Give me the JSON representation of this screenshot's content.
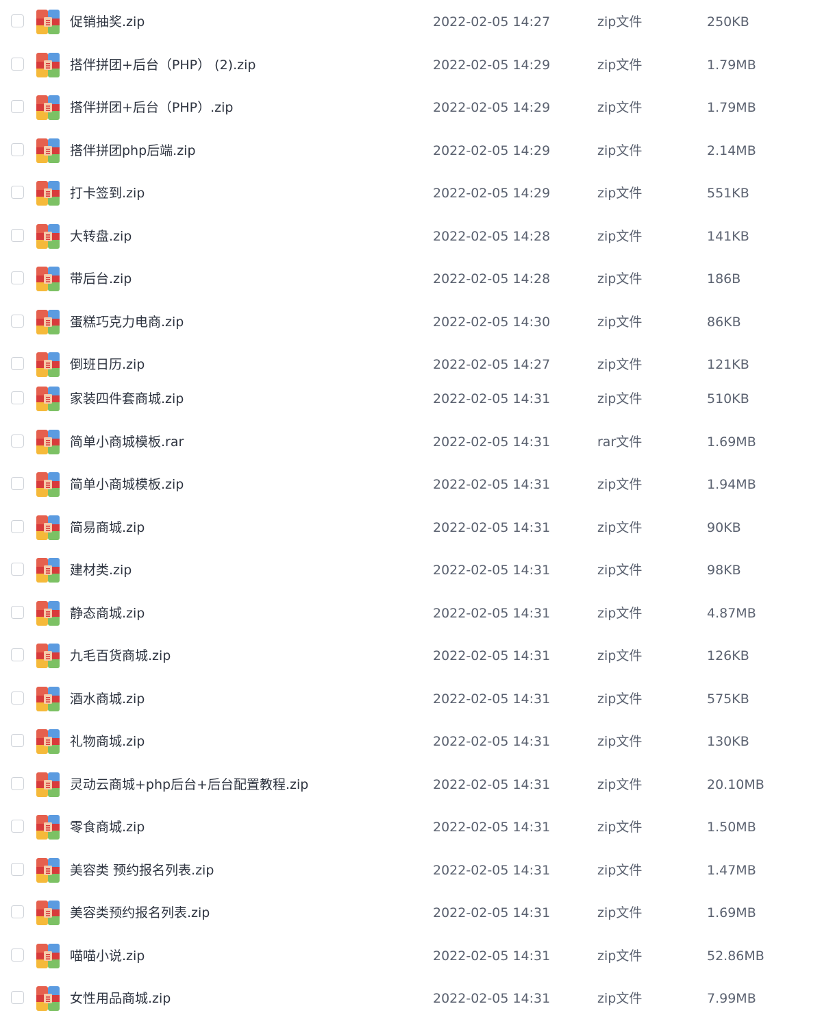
{
  "file_list": {
    "icon": "archive-file-icon",
    "colors": {
      "icon_top_left": "#e5604e",
      "icon_top_right": "#5b9be0",
      "icon_bottom_left": "#f5b93a",
      "icon_bottom_right": "#7cc164",
      "icon_band": "#d83b3b",
      "icon_tag": "#f6c9a8"
    },
    "rows": [
      {
        "name": "促销抽奖.zip",
        "date": "2022-02-05 14:27",
        "type": "zip文件",
        "size": "250KB"
      },
      {
        "name": "搭伴拼团+后台（PHP） (2).zip",
        "date": "2022-02-05 14:29",
        "type": "zip文件",
        "size": "1.79MB"
      },
      {
        "name": "搭伴拼团+后台（PHP）.zip",
        "date": "2022-02-05 14:29",
        "type": "zip文件",
        "size": "1.79MB"
      },
      {
        "name": "搭伴拼团php后端.zip",
        "date": "2022-02-05 14:29",
        "type": "zip文件",
        "size": "2.14MB"
      },
      {
        "name": "打卡签到.zip",
        "date": "2022-02-05 14:29",
        "type": "zip文件",
        "size": "551KB"
      },
      {
        "name": "大转盘.zip",
        "date": "2022-02-05 14:28",
        "type": "zip文件",
        "size": "141KB"
      },
      {
        "name": "带后台.zip",
        "date": "2022-02-05 14:28",
        "type": "zip文件",
        "size": "186B"
      },
      {
        "name": "蛋糕巧克力电商.zip",
        "date": "2022-02-05 14:30",
        "type": "zip文件",
        "size": "86KB"
      },
      {
        "name": "倒班日历.zip",
        "date": "2022-02-05 14:27",
        "type": "zip文件",
        "size": "121KB"
      },
      {
        "name": "家装四件套商城.zip",
        "date": "2022-02-05 14:31",
        "type": "zip文件",
        "size": "510KB"
      },
      {
        "name": "简单小商城模板.rar",
        "date": "2022-02-05 14:31",
        "type": "rar文件",
        "size": "1.69MB"
      },
      {
        "name": "简单小商城模板.zip",
        "date": "2022-02-05 14:31",
        "type": "zip文件",
        "size": "1.94MB"
      },
      {
        "name": "简易商城.zip",
        "date": "2022-02-05 14:31",
        "type": "zip文件",
        "size": "90KB"
      },
      {
        "name": "建材类.zip",
        "date": "2022-02-05 14:31",
        "type": "zip文件",
        "size": "98KB"
      },
      {
        "name": "静态商城.zip",
        "date": "2022-02-05 14:31",
        "type": "zip文件",
        "size": "4.87MB"
      },
      {
        "name": "九毛百货商城.zip",
        "date": "2022-02-05 14:31",
        "type": "zip文件",
        "size": "126KB"
      },
      {
        "name": "酒水商城.zip",
        "date": "2022-02-05 14:31",
        "type": "zip文件",
        "size": "575KB"
      },
      {
        "name": "礼物商城.zip",
        "date": "2022-02-05 14:31",
        "type": "zip文件",
        "size": "130KB"
      },
      {
        "name": "灵动云商城+php后台+后台配置教程.zip",
        "date": "2022-02-05 14:31",
        "type": "zip文件",
        "size": "20.10MB"
      },
      {
        "name": "零食商城.zip",
        "date": "2022-02-05 14:31",
        "type": "zip文件",
        "size": "1.50MB"
      },
      {
        "name": "美容类 预约报名列表.zip",
        "date": "2022-02-05 14:31",
        "type": "zip文件",
        "size": "1.47MB"
      },
      {
        "name": "美容类预约报名列表.zip",
        "date": "2022-02-05 14:31",
        "type": "zip文件",
        "size": "1.69MB"
      },
      {
        "name": "喵喵小说.zip",
        "date": "2022-02-05 14:31",
        "type": "zip文件",
        "size": "52.86MB"
      },
      {
        "name": "女性用品商城.zip",
        "date": "2022-02-05 14:31",
        "type": "zip文件",
        "size": "7.99MB"
      }
    ]
  }
}
